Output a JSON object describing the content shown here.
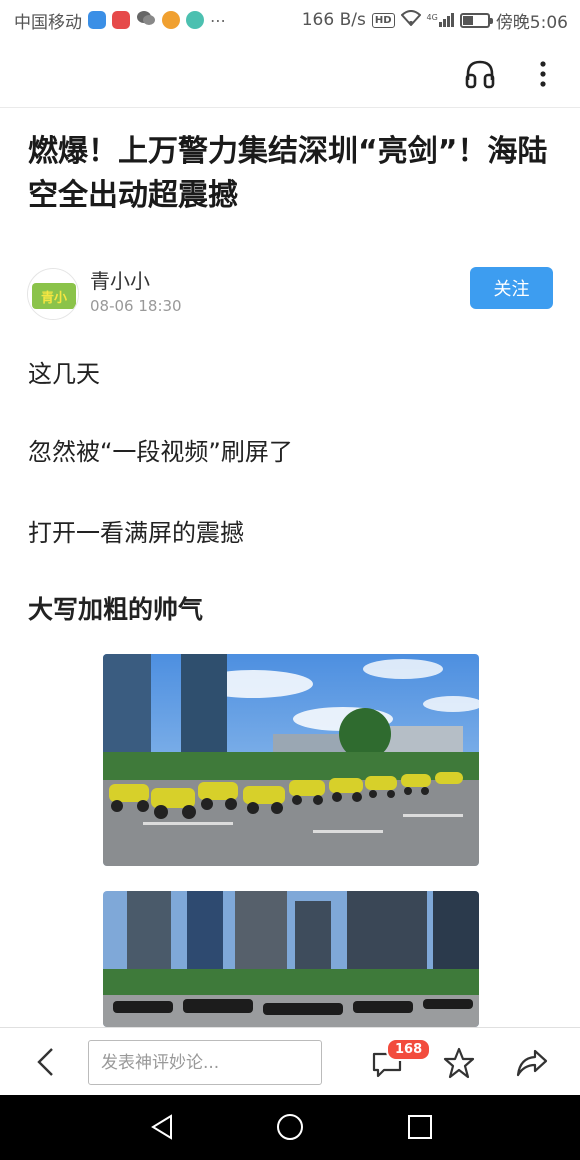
{
  "status_bar": {
    "carrier": "中国移动",
    "network_speed": "166 B/s",
    "hd_label": "HD",
    "signal_label": "4G",
    "time": "傍晚5:06"
  },
  "top_bar": {
    "headphone_icon": "headphone-icon",
    "more_icon": "more-vertical-icon"
  },
  "article": {
    "title": "燃爆！上万警力集结深圳“亮剑”！海陆空全出动超震撼",
    "author": {
      "name": "青小小",
      "avatar_text": "青小小",
      "date": "08-06 18:30",
      "follow_label": "关注"
    },
    "paragraphs": [
      "这几天",
      "忽然被“一段视频”刷屏了",
      "打开一看满屏的震撼"
    ],
    "subheading": "大写加粗的帅气"
  },
  "bottom_bar": {
    "comment_placeholder": "发表神评妙论...",
    "comment_count": "168"
  },
  "colors": {
    "accent": "#3d9df0",
    "badge": "#f24c3d"
  }
}
